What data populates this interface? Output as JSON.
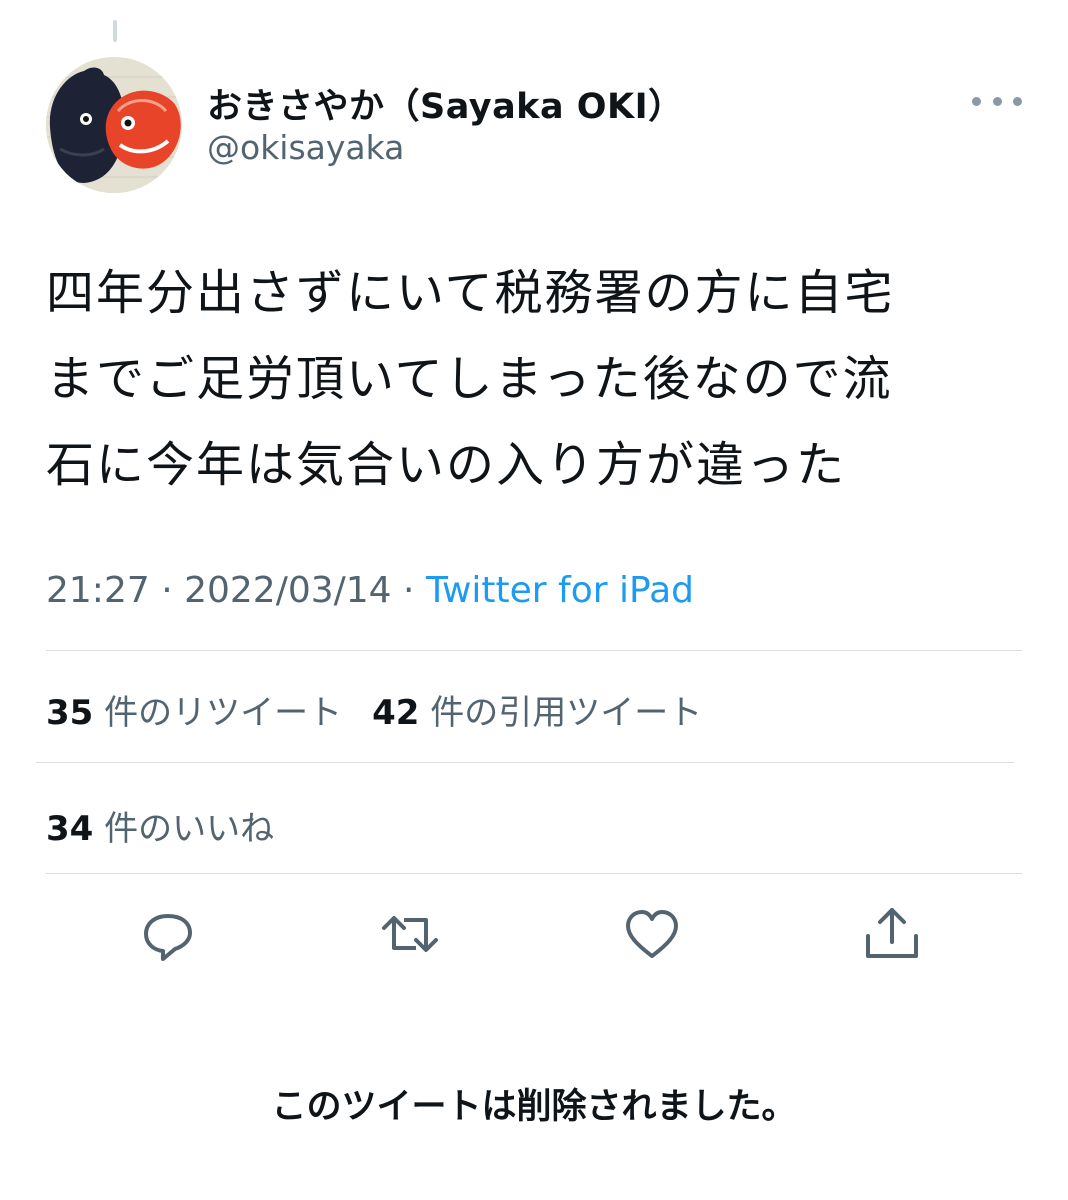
{
  "author": {
    "display_name": "おきさやか（Sayaka OKI）",
    "handle": "@okisayaka"
  },
  "tweet": {
    "lines": [
      "四年分出さずにいて税務署の方に自宅",
      "までご足労頂いてしまった後なので流",
      "石に今年は気合いの入り方が違った"
    ],
    "time": "21:27",
    "date": "2022/03/14",
    "source": "Twitter for iPad",
    "separator": " · "
  },
  "stats": {
    "retweets_count": "35",
    "retweets_label": "件のリツイート",
    "quotes_count": "42",
    "quotes_label": "件の引用ツイート",
    "likes_count": "34",
    "likes_label": "件のいいね"
  },
  "actions": [
    {
      "icon": "reply-icon"
    },
    {
      "icon": "retweet-icon"
    },
    {
      "icon": "like-icon"
    },
    {
      "icon": "share-icon"
    }
  ],
  "notice": "このツイートは削除されました。",
  "colors": {
    "text": "#0f1419",
    "secondary": "#536471",
    "link": "#1d9bf0",
    "divider": "#d9dee2"
  }
}
